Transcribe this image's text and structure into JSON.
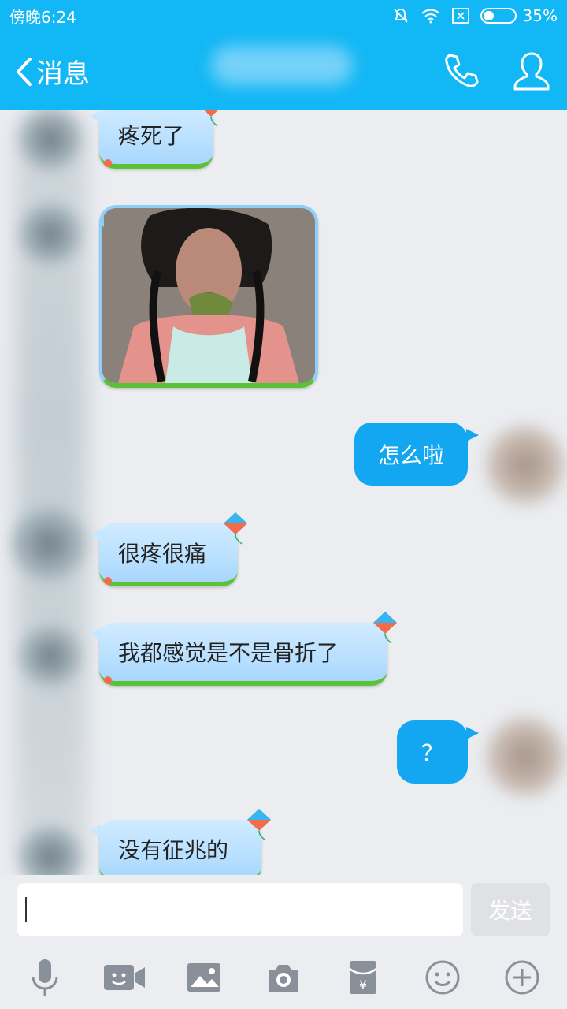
{
  "status_bar": {
    "time": "傍晚6:24",
    "battery": "35%",
    "battery_level": 0.35
  },
  "header": {
    "back_label": "消息"
  },
  "messages": [
    {
      "side": "in",
      "text": "疼死了"
    },
    {
      "side": "in",
      "type": "image"
    },
    {
      "side": "out",
      "text": "怎么啦"
    },
    {
      "side": "in",
      "text": "很疼很痛"
    },
    {
      "side": "in",
      "text": "我都感觉是不是骨折了"
    },
    {
      "side": "out",
      "text": "？"
    },
    {
      "side": "in",
      "text": "没有征兆的"
    }
  ],
  "input": {
    "value": "",
    "send_label": "发送"
  },
  "toolbar": [
    "microphone-icon",
    "video-call-icon",
    "image-icon",
    "camera-icon",
    "red-packet-icon",
    "emoji-icon",
    "plus-icon"
  ],
  "colors": {
    "accent": "#12b7f5",
    "outgoing_bubble": "#12a7f0",
    "incoming_bubble": "#b9e0ff",
    "background": "#ebedf1"
  }
}
